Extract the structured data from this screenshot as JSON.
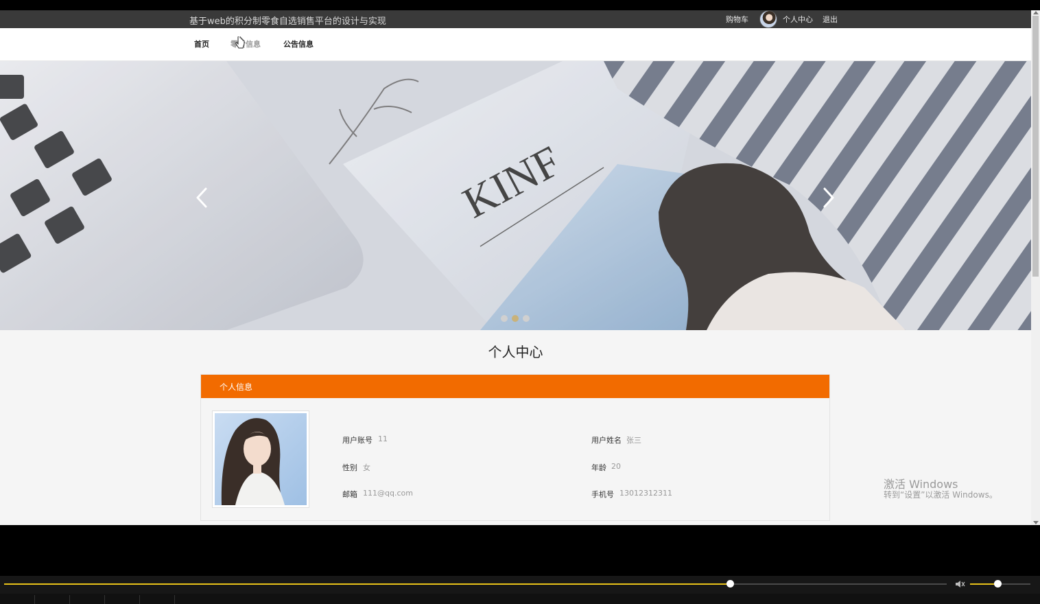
{
  "header": {
    "site_title": "基于web的积分制零食自选销售平台的设计与实现",
    "cart": "购物车",
    "user_center": "个人中心",
    "logout": "退出"
  },
  "nav": {
    "items": [
      {
        "label": "首页"
      },
      {
        "label": "零食信息"
      },
      {
        "label": "公告信息"
      }
    ]
  },
  "carousel": {
    "slide_count": 3,
    "active_index": 1
  },
  "profile": {
    "section_title": "个人中心",
    "card_title": "个人信息",
    "fields": {
      "account_label": "用户账号",
      "account_value": "11",
      "name_label": "用户姓名",
      "name_value": "张三",
      "gender_label": "性别",
      "gender_value": "女",
      "age_label": "年龄",
      "age_value": "20",
      "email_label": "邮箱",
      "email_value": "111@qq.com",
      "phone_label": "手机号",
      "phone_value": "13012312311"
    }
  },
  "watermark": {
    "line1": "激活 Windows",
    "line2": "转到“设置”以激活 Windows。"
  },
  "player": {
    "progress": 0.77,
    "volume": 0.45
  },
  "colors": {
    "accent": "#f26b00",
    "topbar": "#3a3a3a",
    "progress": "#e8c21a"
  }
}
